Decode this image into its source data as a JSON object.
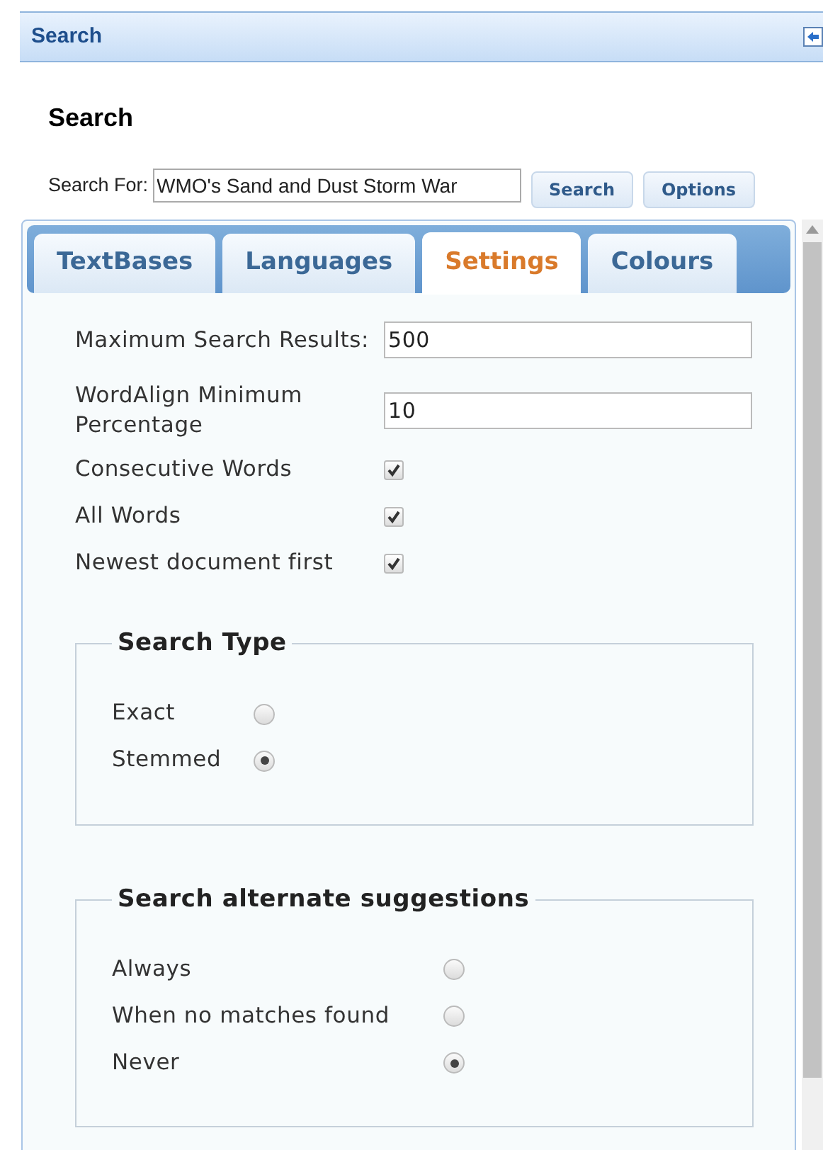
{
  "title_bar": {
    "title": "Search"
  },
  "heading": "Search",
  "search": {
    "label": "Search For:",
    "value": "WMO's Sand and Dust Storm War",
    "buttons": [
      "Search",
      "Options"
    ]
  },
  "tabs": [
    {
      "label": "TextBases",
      "selected": false
    },
    {
      "label": "Languages",
      "selected": false
    },
    {
      "label": "Settings",
      "selected": true
    },
    {
      "label": "Colours",
      "selected": false
    }
  ],
  "settings": [
    {
      "kind": "text",
      "label": "Maximum Search Results:",
      "value": "500"
    },
    {
      "kind": "text",
      "label": "WordAlign Minimum Percentage",
      "value": "10"
    },
    {
      "kind": "checkbox",
      "label": "Consecutive Words",
      "checked": true
    },
    {
      "kind": "checkbox",
      "label": "All Words",
      "checked": true
    },
    {
      "kind": "checkbox",
      "label": "Newest document first",
      "checked": true
    }
  ],
  "groups": [
    {
      "legend": "Search Type",
      "options": [
        {
          "label": "Exact",
          "selected": false
        },
        {
          "label": "Stemmed",
          "selected": true
        }
      ]
    },
    {
      "legend": "Search alternate suggestions",
      "options": [
        {
          "label": "Always",
          "selected": false
        },
        {
          "label": "When no matches found",
          "selected": false
        },
        {
          "label": "Never",
          "selected": true
        }
      ]
    }
  ]
}
